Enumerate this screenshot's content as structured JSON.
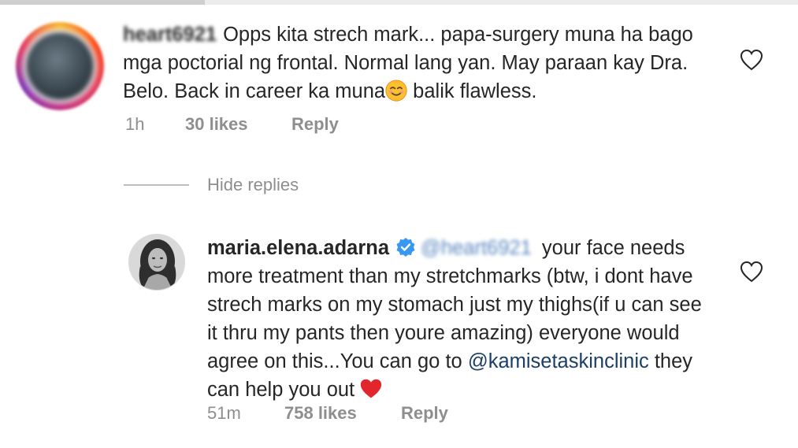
{
  "comments": [
    {
      "username": "heart6921",
      "text": "Opps kita strech mark... papa-surgery muna ha bago mga poctorial ng frontal. Normal lang yan. May paraan kay Dra. Belo. Back in career ka muna",
      "text_after_emoji": " balik flawless.",
      "emoji": "smiling-face-emoji",
      "time": "1h",
      "likes": "30 likes",
      "reply": "Reply"
    },
    {
      "username": "maria.elena.adarna",
      "verified": true,
      "mention": "@heart6921",
      "text": " your face needs more treatment than my stretchmarks (btw, i dont have strech marks on my stomach just my thighs(if u can see it thru my pants then youre amazing) everyone would agree on this...You can go to ",
      "link": "@kamisetaskinclinic",
      "text_after_link": " they can help you out ",
      "emoji": "red-heart-emoji",
      "time": "51m",
      "likes": "758 likes",
      "reply": "Reply"
    }
  ],
  "hide_replies": "Hide replies",
  "colors": {
    "text": "#262626",
    "meta": "#8e8e8e",
    "mention": "#1b3f66",
    "verified": "#3897f0",
    "heart": "#e3262b"
  },
  "icons": [
    "heart-outline-icon",
    "verified-badge-icon"
  ]
}
